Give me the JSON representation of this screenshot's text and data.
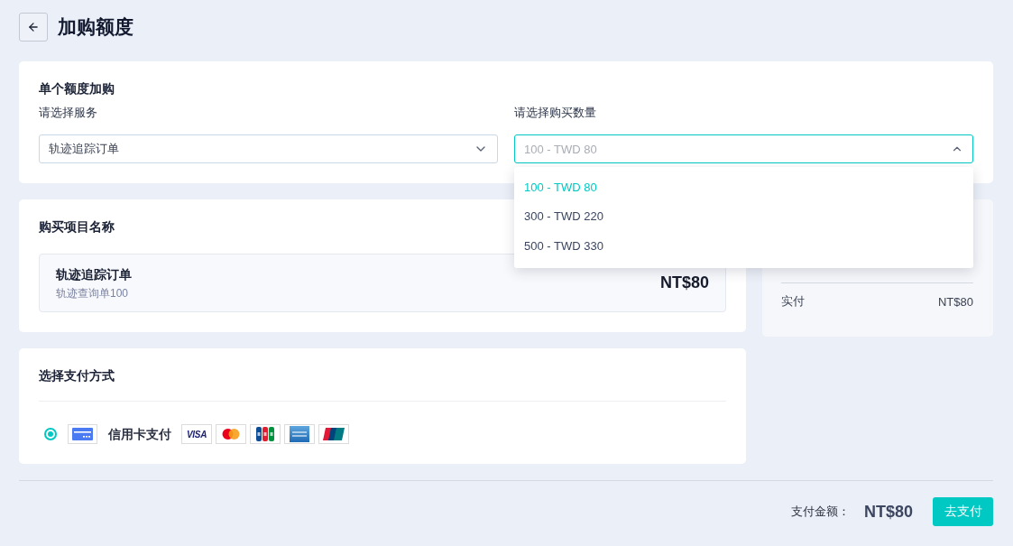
{
  "page": {
    "title": "加购额度"
  },
  "single_purchase": {
    "title": "单个额度加购",
    "selects": [
      {
        "label": "请选择服务",
        "value": "轨迹追踪订单",
        "expanded": false
      },
      {
        "label": "请选择购买数量",
        "value": "100 - TWD 80",
        "expanded": true,
        "options": [
          {
            "label": "100 - TWD 80",
            "selected": true
          },
          {
            "label": "300 - TWD 220",
            "selected": false
          },
          {
            "label": "500 - TWD 330",
            "selected": false
          }
        ]
      }
    ]
  },
  "item": {
    "title": "购买项目名称",
    "name": "轨迹追踪订单",
    "description": "轨迹查询单100",
    "price": "NT$80"
  },
  "summary": {
    "rows": [
      {
        "label": "实付",
        "value": "NT$80"
      }
    ]
  },
  "payment": {
    "title": "选择支付方式",
    "methods": [
      {
        "label": "信用卡支付",
        "selected": true,
        "brands": [
          {
            "kind": "visa",
            "label": "VISA"
          },
          {
            "kind": "mastercard"
          },
          {
            "kind": "jcb"
          },
          {
            "kind": "amex"
          },
          {
            "kind": "unionpay"
          }
        ]
      }
    ]
  },
  "footer": {
    "amount_label": "支付金额：",
    "amount": "NT$80",
    "pay_button": "去支付"
  }
}
